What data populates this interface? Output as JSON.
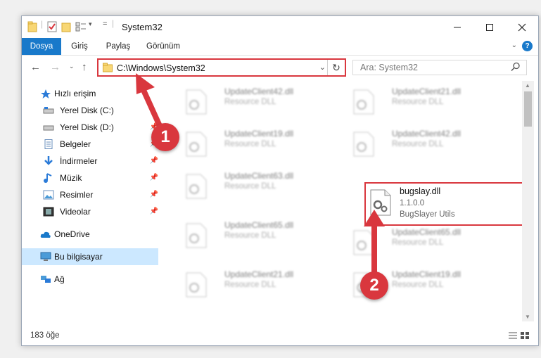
{
  "window": {
    "title": "System32",
    "controls": {
      "minimize": "minimize-icon",
      "maximize": "maximize-icon",
      "close": "close-icon"
    }
  },
  "ribbon": {
    "tabs": [
      {
        "label": "Dosya",
        "active": true
      },
      {
        "label": "Giriş",
        "active": false
      },
      {
        "label": "Paylaş",
        "active": false
      },
      {
        "label": "Görünüm",
        "active": false
      }
    ],
    "help_label": "?"
  },
  "nav": {
    "address": "C:\\Windows\\System32",
    "search_placeholder": "Ara: System32"
  },
  "sidebar": {
    "items": [
      {
        "label": "Hızlı erişim",
        "icon": "star-icon",
        "level": "top",
        "pinned": false
      },
      {
        "label": "Yerel Disk (C:)",
        "icon": "drive-icon",
        "level": "child",
        "pinned": false
      },
      {
        "label": "Yerel Disk (D:)",
        "icon": "drive-icon",
        "level": "child",
        "pinned": true
      },
      {
        "label": "Belgeler",
        "icon": "documents-icon",
        "level": "child",
        "pinned": true
      },
      {
        "label": "İndirmeler",
        "icon": "download-icon",
        "level": "child",
        "pinned": true
      },
      {
        "label": "Müzik",
        "icon": "music-icon",
        "level": "child",
        "pinned": true
      },
      {
        "label": "Resimler",
        "icon": "pictures-icon",
        "level": "child",
        "pinned": true
      },
      {
        "label": "Videolar",
        "icon": "videos-icon",
        "level": "child",
        "pinned": true
      },
      {
        "label": "OneDrive",
        "icon": "cloud-icon",
        "level": "top",
        "pinned": false
      },
      {
        "label": "Bu bilgisayar",
        "icon": "computer-icon",
        "level": "top",
        "pinned": false,
        "selected": true
      },
      {
        "label": "Ağ",
        "icon": "network-icon",
        "level": "top",
        "pinned": false
      }
    ]
  },
  "files": [
    {
      "name": "UpdateClient42.dll",
      "line2": "Resource DLL",
      "line3": "",
      "blurred": true,
      "highlight": false
    },
    {
      "name": "UpdateClient21.dll",
      "line2": "Resource DLL",
      "line3": "",
      "blurred": true,
      "highlight": false
    },
    {
      "name": "UpdateClient19.dll",
      "line2": "Resource DLL",
      "line3": "",
      "blurred": true,
      "highlight": false
    },
    {
      "name": "UpdateClient42.dll",
      "line2": "Resource DLL",
      "line3": "",
      "blurred": true,
      "highlight": false
    },
    {
      "name": "UpdateClient63.dll",
      "line2": "Resource DLL",
      "line3": "",
      "blurred": true,
      "highlight": false
    },
    {
      "name": "bugslay.dll",
      "line2": "1.1.0.0",
      "line3": "BugSlayer Utils",
      "blurred": false,
      "highlight": true
    },
    {
      "name": "UpdateClient65.dll",
      "line2": "Resource DLL",
      "line3": "",
      "blurred": true,
      "highlight": false
    },
    {
      "name": "UpdateClient65.dll",
      "line2": "Resource DLL",
      "line3": "",
      "blurred": true,
      "highlight": false
    },
    {
      "name": "UpdateClient21.dll",
      "line2": "Resource DLL",
      "line3": "",
      "blurred": true,
      "highlight": false
    },
    {
      "name": "UpdateClient19.dll",
      "line2": "Resource DLL",
      "line3": "",
      "blurred": true,
      "highlight": false
    }
  ],
  "status": {
    "item_count": "183 öğe"
  },
  "annotations": {
    "step1": "1",
    "step2": "2",
    "color": "#d9373e"
  },
  "colors": {
    "accent": "#1979ca",
    "highlight": "#d9373e",
    "selected_bg": "#cce8ff"
  }
}
